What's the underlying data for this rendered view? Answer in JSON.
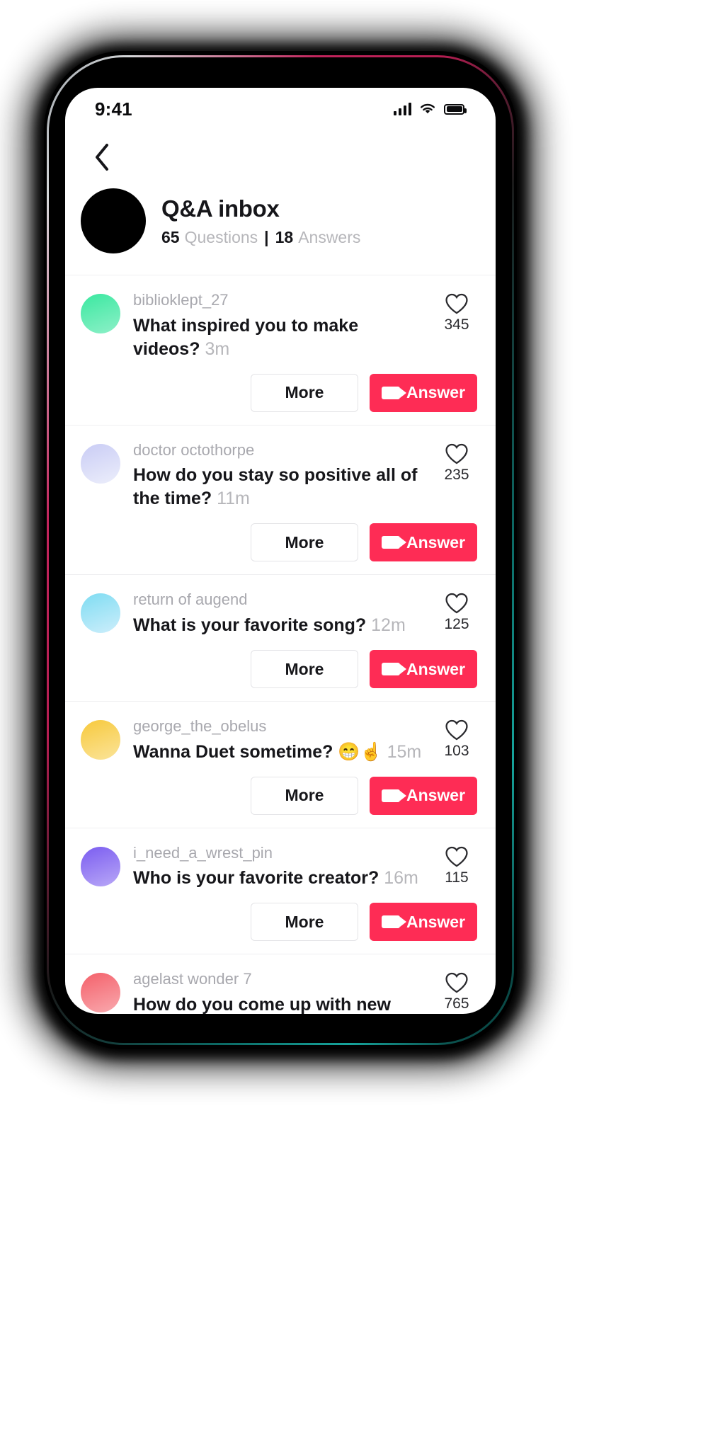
{
  "status_bar": {
    "time": "9:41",
    "icons": [
      "cellular-signal-icon",
      "wifi-icon",
      "battery-icon"
    ]
  },
  "nav": {
    "back_icon": "chevron-left-icon"
  },
  "header": {
    "avatar": "profile-avatar",
    "title": "Q&A inbox",
    "questions_count": "65",
    "questions_label": "Questions",
    "separator": "|",
    "answers_count": "18",
    "answers_label": "Answers"
  },
  "buttons": {
    "more_label": "More",
    "answer_label": "Answer",
    "answer_icon": "video-camera-icon",
    "accent_color": "#FE2C55"
  },
  "questions": [
    {
      "username": "biblioklept_27",
      "text": "What inspired you to make videos?",
      "time": "3m",
      "likes": "345",
      "avatar_from": "#3ae8a0",
      "avatar_to": "#8ef0c8"
    },
    {
      "username": "doctor octothorpe",
      "text": "How do you stay so positive all of the time?",
      "time": "11m",
      "likes": "235",
      "avatar_from": "#c9ccf5",
      "avatar_to": "#eceefb"
    },
    {
      "username": "return of augend",
      "text": "What is your favorite song?",
      "time": "12m",
      "likes": "125",
      "avatar_from": "#7edcf2",
      "avatar_to": "#cdeefb"
    },
    {
      "username": "george_the_obelus",
      "text": "Wanna Duet sometime? 😁☝️",
      "time": "15m",
      "likes": "103",
      "avatar_from": "#f7c93c",
      "avatar_to": "#fbe49a"
    },
    {
      "username": "i_need_a_wrest_pin",
      "text": "Who is your favorite creator?",
      "time": "16m",
      "likes": "115",
      "avatar_from": "#7a5cf0",
      "avatar_to": "#b9a8f7"
    },
    {
      "username": "agelast wonder 7",
      "text": "How do you come up with new video",
      "time": "",
      "likes": "765",
      "avatar_from": "#f4606a",
      "avatar_to": "#f9a9ae"
    }
  ]
}
